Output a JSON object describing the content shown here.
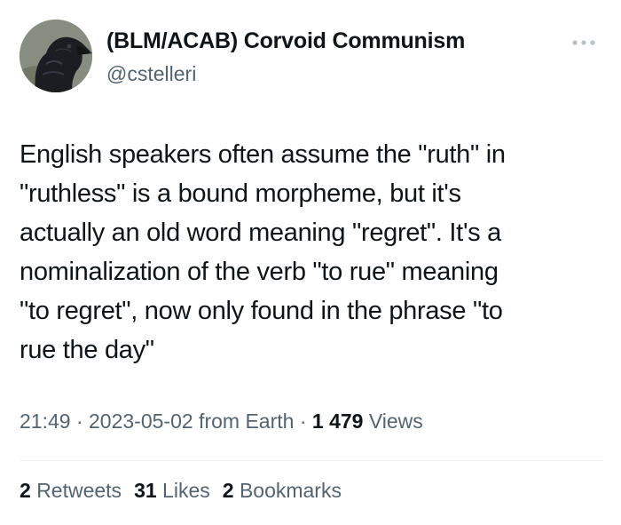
{
  "author": {
    "display_name": "(BLM/ACAB) Corvoid Communism",
    "handle": "@cstelleri",
    "avatar_icon": "crow-avatar"
  },
  "more_icon": "more-horizontal-icon",
  "tweet": {
    "text": "English speakers often assume the \"ruth\" in\n\"ruthless\" is a bound morpheme, but it's\nactually an old word meaning \"regret\". It's a\nnominalization of the verb \"to rue\" meaning\n\"to regret\", now only found in the phrase \"to\nrue the day\""
  },
  "meta": {
    "time": "21:49",
    "sep1": " · ",
    "date": "2023-05-02",
    "source": " from Earth",
    "sep2": " · ",
    "views_count": "1 479",
    "views_label": " Views"
  },
  "stats": {
    "retweets_count": "2",
    "retweets_label": "Retweets",
    "likes_count": "31",
    "likes_label": "Likes",
    "bookmarks_count": "2",
    "bookmarks_label": "Bookmarks"
  },
  "colors": {
    "text_primary": "#0f1419",
    "text_secondary": "#536471",
    "divider": "#eff3f4"
  }
}
